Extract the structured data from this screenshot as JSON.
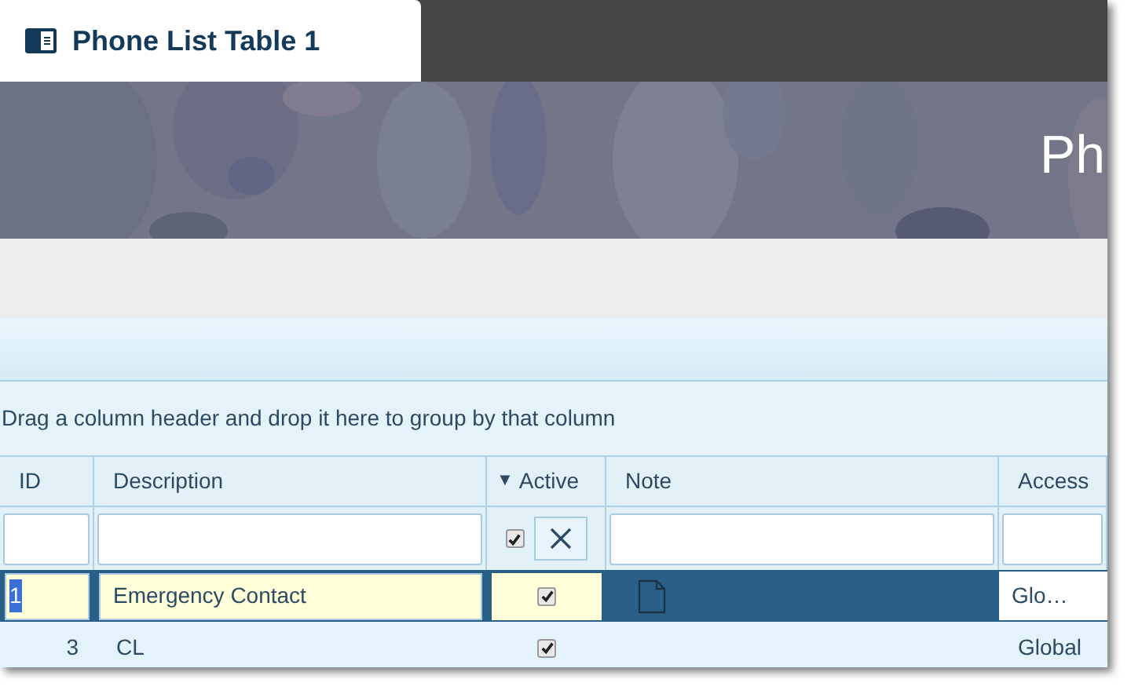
{
  "tab": {
    "title": "Phone List Table 1"
  },
  "banner": {
    "title": "Ph"
  },
  "group_panel": {
    "text": "Drag a column header and drop it here to group by that column"
  },
  "columns": [
    {
      "label": "ID",
      "sorted": false
    },
    {
      "label": "Description",
      "sorted": false
    },
    {
      "label": "Active",
      "sorted": true,
      "sort_indicator": "▼"
    },
    {
      "label": "Note",
      "sorted": false
    },
    {
      "label": "Access",
      "sorted": false
    }
  ],
  "filters": {
    "active_checked": true
  },
  "rows": [
    {
      "id": "1",
      "description": "Emergency Contact",
      "active": true,
      "has_note": true,
      "access": "Glo…",
      "selected": true
    },
    {
      "id": "3",
      "description": "CL",
      "active": true,
      "has_note": false,
      "access": "Global",
      "selected": false
    }
  ]
}
